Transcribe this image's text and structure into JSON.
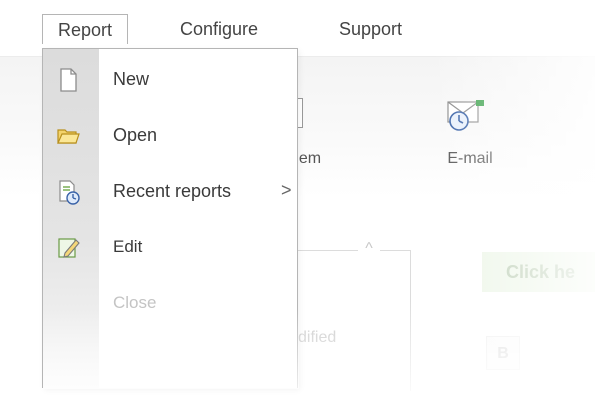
{
  "menubar": {
    "items": [
      {
        "label": "Report",
        "active": true
      },
      {
        "label": "Configure",
        "active": false
      },
      {
        "label": "Support",
        "active": false
      }
    ]
  },
  "toolbar": {
    "item_label": "em",
    "email_label": "E-mail"
  },
  "dropdown": {
    "items": [
      {
        "label": "New",
        "icon": "new-document-icon",
        "enabled": true
      },
      {
        "label": "Open",
        "icon": "folder-open-icon",
        "enabled": true
      },
      {
        "label": "Recent reports",
        "icon": "recent-reports-icon",
        "enabled": true,
        "submenu": true,
        "submenu_indicator": ">"
      },
      {
        "label": "Edit",
        "icon": "edit-icon",
        "enabled": true
      },
      {
        "label": "Close",
        "icon": "",
        "enabled": false
      }
    ]
  },
  "background": {
    "collapse_glyph": "^",
    "modified_text": "dified",
    "click_here_text": "Click he",
    "bold_button": "B"
  },
  "colors": {
    "menu_border": "#b5b5b5",
    "gutter": "#dcdcdc",
    "disabled_text": "#c4c4c4",
    "click_here_bg": "#edf6e8"
  }
}
